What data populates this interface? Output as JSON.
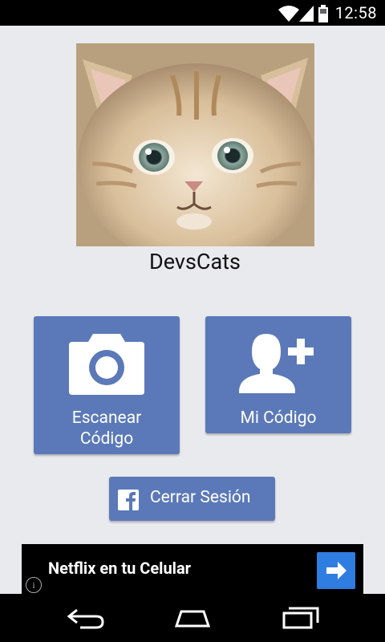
{
  "status_bar": {
    "time": "12:58"
  },
  "profile": {
    "username": "DevsCats"
  },
  "tiles": {
    "scan": {
      "line1": "Escanear",
      "line2": "Código"
    },
    "my_code": {
      "label": "Mi Código"
    }
  },
  "logout": {
    "label": "Cerrar Sesión"
  },
  "ad": {
    "headline": "Netflix en tu Celular",
    "info": "i"
  },
  "colors": {
    "accent": "#5b79b8",
    "background": "#e9eaee",
    "ad_button": "#2f7de1"
  }
}
